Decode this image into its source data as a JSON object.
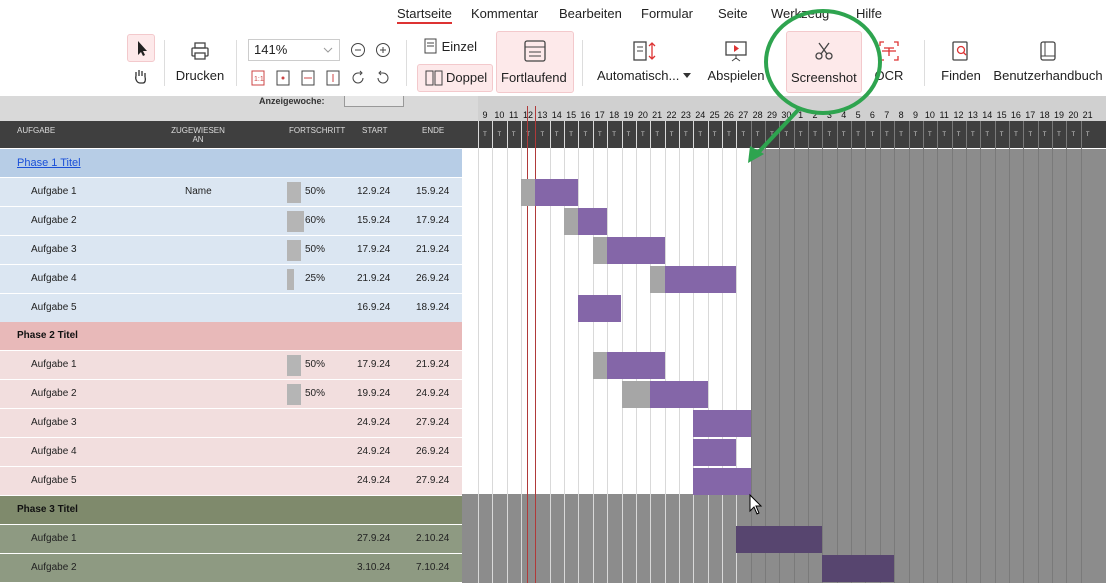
{
  "menu": {
    "tabs": [
      {
        "label": "Startseite",
        "active": true
      },
      {
        "label": "Kommentar"
      },
      {
        "label": "Bearbeiten"
      },
      {
        "label": "Formular"
      },
      {
        "label": "Seite"
      },
      {
        "label": "Werkzeug"
      },
      {
        "label": "Hilfe"
      }
    ]
  },
  "toolbar": {
    "print_label": "Drucken",
    "zoom_value": "141%",
    "single_label": "Einzel",
    "double_label": "Doppel",
    "continuous_label": "Fortlaufend",
    "auto_label": "Automatisch...",
    "play_label": "Abspielen",
    "screenshot_label": "Screenshot",
    "ocr_label": "OCR",
    "find_label": "Finden",
    "manual_label": "Benutzerhandbuch"
  },
  "colors": {
    "phase1_header": "#b7cde6",
    "phase1_row": "#dbe6f2",
    "phase2_header": "#e8b9b9",
    "phase2_row": "#f2dede",
    "phase3_header": "#7f8a6c",
    "phase3_row": "#8e9a82",
    "bar_purple": "#8466a8",
    "bar_dark": "#57456f",
    "bar_gray": "#a6a6a6",
    "annotation_green": "#2ea44f",
    "highlight": "#fde9ea"
  },
  "gantt": {
    "week_label": "Anzeigewoche:",
    "columns": {
      "task": "AUFGABE",
      "assigned": "ZUGEWIESEN AN",
      "progress": "FORTSCHRITT",
      "start": "START",
      "end": "ENDE"
    },
    "day_letter": "T",
    "days": [
      "9",
      "10",
      "11",
      "12",
      "13",
      "14",
      "15",
      "16",
      "17",
      "18",
      "19",
      "20",
      "21",
      "22",
      "23",
      "24",
      "25",
      "26",
      "27",
      "28",
      "29",
      "30",
      "1",
      "2",
      "3",
      "4",
      "5",
      "6",
      "7",
      "8",
      "9",
      "10",
      "11",
      "12",
      "13",
      "14",
      "15",
      "16",
      "17",
      "18",
      "19",
      "20",
      "21"
    ],
    "rows": [
      {
        "type": "phase",
        "phase": 1,
        "title": "Phase 1 Titel",
        "link": true
      },
      {
        "type": "task",
        "phase": 1,
        "name": "Aufgabe 1",
        "assigned": "Name",
        "progress": "50%",
        "start": "12.9.24",
        "end": "15.9.24"
      },
      {
        "type": "task",
        "phase": 1,
        "name": "Aufgabe 2",
        "assigned": "",
        "progress": "60%",
        "start": "15.9.24",
        "end": "17.9.24"
      },
      {
        "type": "task",
        "phase": 1,
        "name": "Aufgabe 3",
        "assigned": "",
        "progress": "50%",
        "start": "17.9.24",
        "end": "21.9.24"
      },
      {
        "type": "task",
        "phase": 1,
        "name": "Aufgabe 4",
        "assigned": "",
        "progress": "25%",
        "start": "21.9.24",
        "end": "26.9.24"
      },
      {
        "type": "task",
        "phase": 1,
        "name": "Aufgabe 5",
        "assigned": "",
        "progress": "",
        "start": "16.9.24",
        "end": "18.9.24"
      },
      {
        "type": "phase",
        "phase": 2,
        "title": "Phase 2 Titel"
      },
      {
        "type": "task",
        "phase": 2,
        "name": "Aufgabe 1",
        "assigned": "",
        "progress": "50%",
        "start": "17.9.24",
        "end": "21.9.24"
      },
      {
        "type": "task",
        "phase": 2,
        "name": "Aufgabe 2",
        "assigned": "",
        "progress": "50%",
        "start": "19.9.24",
        "end": "24.9.24"
      },
      {
        "type": "task",
        "phase": 2,
        "name": "Aufgabe 3",
        "assigned": "",
        "progress": "",
        "start": "24.9.24",
        "end": "27.9.24"
      },
      {
        "type": "task",
        "phase": 2,
        "name": "Aufgabe 4",
        "assigned": "",
        "progress": "",
        "start": "24.9.24",
        "end": "26.9.24"
      },
      {
        "type": "task",
        "phase": 2,
        "name": "Aufgabe 5",
        "assigned": "",
        "progress": "",
        "start": "24.9.24",
        "end": "27.9.24"
      },
      {
        "type": "phase",
        "phase": 3,
        "title": "Phase 3 Titel"
      },
      {
        "type": "task",
        "phase": 3,
        "name": "Aufgabe 1",
        "assigned": "",
        "progress": "",
        "start": "27.9.24",
        "end": "2.10.24"
      },
      {
        "type": "task",
        "phase": 3,
        "name": "Aufgabe 2",
        "assigned": "",
        "progress": "",
        "start": "3.10.24",
        "end": "7.10.24"
      }
    ]
  }
}
